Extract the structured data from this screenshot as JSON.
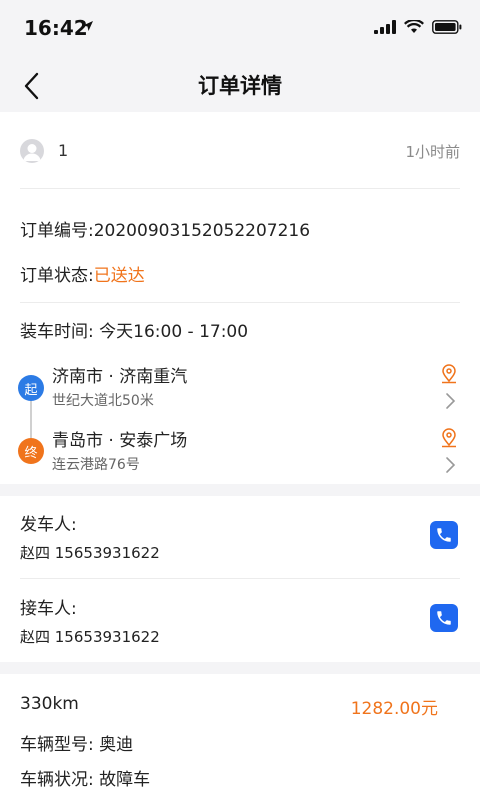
{
  "status_bar": {
    "time": "16:42"
  },
  "nav": {
    "title": "订单详情"
  },
  "user": {
    "name": "1",
    "time_ago": "1小时前"
  },
  "order": {
    "number_label": "订单编号:",
    "number": "20200903152052207216",
    "status_label": "订单状态:",
    "status": "已送达",
    "load_time_label": "装车时间:",
    "load_time": "今天16:00 - 17:00"
  },
  "route": {
    "start": {
      "badge": "起",
      "title": "济南市 · 济南重汽",
      "address": "世纪大道北50米"
    },
    "end": {
      "badge": "终",
      "title": "青岛市 · 安泰广场",
      "address": "连云港路76号"
    }
  },
  "sender": {
    "label": "发车人:",
    "info": "赵四 15653931622"
  },
  "receiver": {
    "label": "接车人:",
    "info": "赵四 15653931622"
  },
  "summary": {
    "distance": "330km",
    "price": "1282.00元",
    "model_label": "车辆型号:",
    "model": "奥迪",
    "condition_label": "车辆状况:",
    "condition": "故障车"
  },
  "colors": {
    "accent_orange": "#f0741c",
    "phone_blue": "#1f68f0",
    "start_blue": "#2c7be5"
  }
}
